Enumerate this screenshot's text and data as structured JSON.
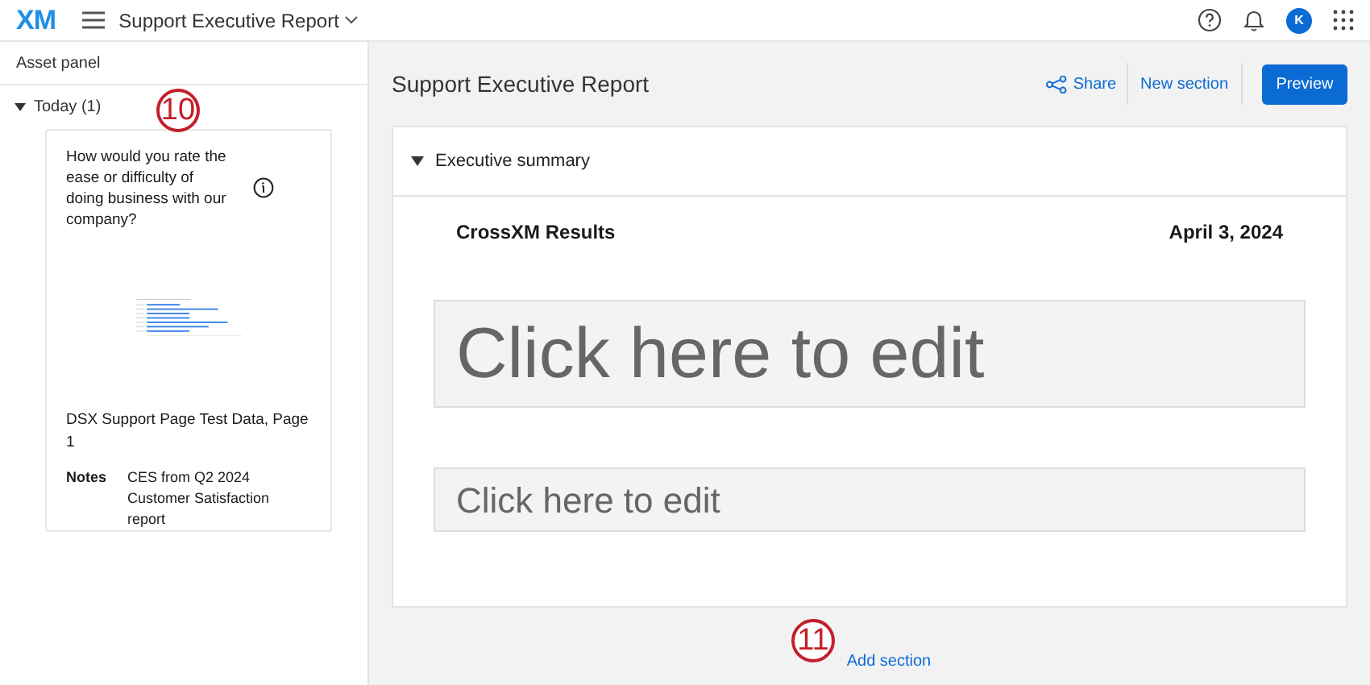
{
  "header": {
    "logo": "XM",
    "title": "Support Executive Report",
    "avatar": "K"
  },
  "asset_panel": {
    "title": "Asset panel",
    "group": {
      "label": "Today (1)",
      "expanded": true
    },
    "card": {
      "question": "How would you rate the ease or difficulty of doing business with our company?",
      "source": "DSX Support Page Test Data, Page 1",
      "notes_label": "Notes",
      "notes": "CES from Q2 2024 Customer Satisfaction report"
    }
  },
  "report": {
    "title": "Support Executive Report",
    "actions": [
      "Share",
      "New section"
    ],
    "primary_action": "Preview",
    "section": {
      "title": "Executive summary",
      "expanded": true,
      "heading": "CrossXM Results",
      "date": "April 3, 2024",
      "blocks": [
        {
          "kind": "large",
          "placeholder": "Click here to edit"
        },
        {
          "kind": "small",
          "placeholder": "Click here to edit"
        }
      ]
    },
    "add_section": "Add section"
  },
  "callouts": [
    "10",
    "11"
  ]
}
